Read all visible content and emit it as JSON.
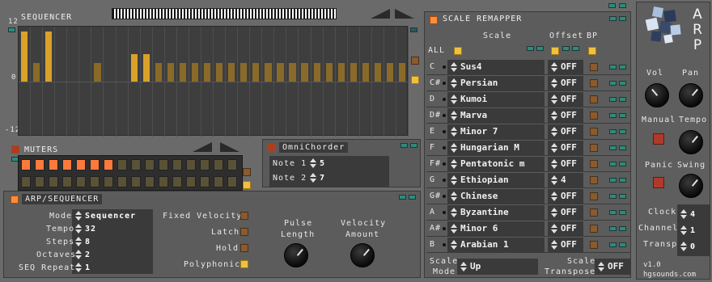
{
  "sequencer": {
    "title": "SEQUENCER",
    "axis": {
      "top": "12",
      "mid": "0",
      "bottom": "-12"
    },
    "bars": [
      11,
      4,
      11,
      0,
      0,
      0,
      4,
      0,
      0,
      6,
      6,
      4,
      4,
      4,
      4,
      4,
      4,
      4,
      4,
      4,
      4,
      4,
      4,
      4,
      4,
      4,
      4,
      4,
      4,
      4,
      4,
      4
    ],
    "bar_range": [
      -12,
      12
    ]
  },
  "muters": {
    "title": "MUTERS",
    "top_row": [
      true,
      true,
      true,
      true,
      true,
      true,
      true,
      false,
      false,
      false,
      false,
      false,
      false,
      false,
      false,
      false
    ],
    "bottom_row": [
      false,
      false,
      false,
      false,
      false,
      false,
      false,
      false,
      false,
      false,
      false,
      false,
      false,
      false,
      false,
      false
    ]
  },
  "omnichorder": {
    "title": "OmniChorder",
    "note1_label": "Note 1",
    "note1_value": "5",
    "note2_label": "Note 2",
    "note2_value": "7"
  },
  "arp_seq": {
    "title": "ARP/SEQUENCER",
    "mode_label": "Mode",
    "mode_value": "Sequencer",
    "tempo_label": "Tempo",
    "tempo_value": "32",
    "steps_label": "Steps",
    "steps_value": "8",
    "octaves_label": "Octaves",
    "octaves_value": "2",
    "repeat_label": "SEQ Repeat",
    "repeat_value": "1",
    "fixed_velocity": "Fixed Velocity",
    "latch": "Latch",
    "hold": "Hold",
    "polyphonic": "Polyphonic",
    "pulse_length_1": "Pulse",
    "pulse_length_2": "Length",
    "velocity_amount_1": "Velocity",
    "velocity_amount_2": "Amount"
  },
  "remapper": {
    "title": "SCALE REMAPPER",
    "col_scale": "Scale",
    "col_offset": "Offset",
    "col_bp": "BP",
    "all_label": "ALL",
    "rows": [
      {
        "note": "C",
        "scale": "Sus4",
        "offset": "OFF"
      },
      {
        "note": "C#",
        "scale": "Persian",
        "offset": "OFF"
      },
      {
        "note": "D",
        "scale": "Kumoi",
        "offset": "OFF"
      },
      {
        "note": "D#",
        "scale": "Marva",
        "offset": "OFF"
      },
      {
        "note": "E",
        "scale": "Minor 7",
        "offset": "OFF"
      },
      {
        "note": "F",
        "scale": "Hungarian M",
        "offset": "OFF"
      },
      {
        "note": "F#",
        "scale": "Pentatonic m",
        "offset": "OFF"
      },
      {
        "note": "G",
        "scale": "Ethiopian",
        "offset": "4"
      },
      {
        "note": "G#",
        "scale": "Chinese",
        "offset": "OFF"
      },
      {
        "note": "A",
        "scale": "Byzantine",
        "offset": "OFF"
      },
      {
        "note": "A#",
        "scale": "Minor 6",
        "offset": "OFF"
      },
      {
        "note": "B",
        "scale": "Arabian 1",
        "offset": "OFF"
      }
    ],
    "scale_mode_label_1": "Scale",
    "scale_mode_label_2": "Mode",
    "scale_mode_value": "Up",
    "scale_transpose_label_1": "Scale",
    "scale_transpose_label_2": "Transpose",
    "scale_transpose_value": "OFF"
  },
  "right": {
    "logo": "ARP",
    "vol": "Vol",
    "pan": "Pan",
    "manual": "Manual",
    "tempo": "Tempo",
    "panic": "Panic",
    "swing": "Swing",
    "clock_label": "Clock",
    "clock_value": "4",
    "channel_label": "Channel",
    "channel_value": "1",
    "transp_label": "Transp",
    "transp_value": "0",
    "version": "v1.0",
    "site": "hgsounds.com"
  },
  "colors": {
    "accent_orange": "#ff8c3a",
    "bar_gold": "#d9a12a",
    "bar_brown": "#8a6a28",
    "teal": "#2f8a7a"
  }
}
